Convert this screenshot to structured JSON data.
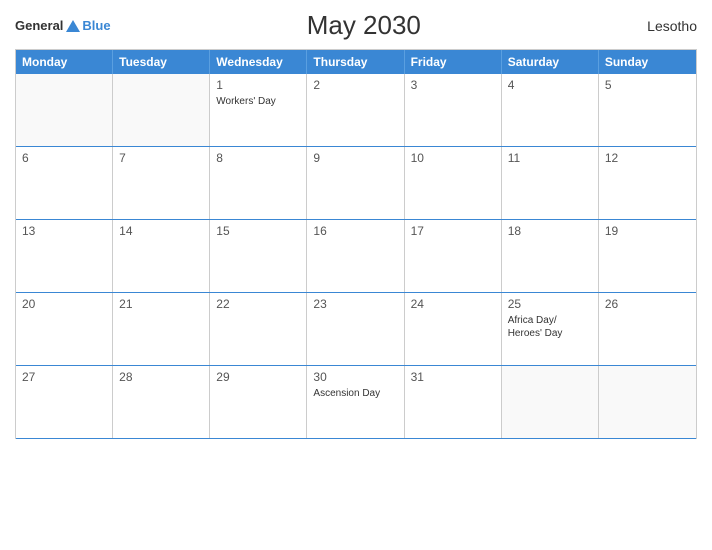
{
  "logo": {
    "general": "General",
    "blue": "Blue"
  },
  "title": "May 2030",
  "country": "Lesotho",
  "headers": [
    "Monday",
    "Tuesday",
    "Wednesday",
    "Thursday",
    "Friday",
    "Saturday",
    "Sunday"
  ],
  "weeks": [
    [
      {
        "day": "",
        "event": "",
        "empty": true
      },
      {
        "day": "",
        "event": "",
        "empty": true
      },
      {
        "day": "1",
        "event": "Workers' Day",
        "empty": false
      },
      {
        "day": "2",
        "event": "",
        "empty": false
      },
      {
        "day": "3",
        "event": "",
        "empty": false
      },
      {
        "day": "4",
        "event": "",
        "empty": false
      },
      {
        "day": "5",
        "event": "",
        "empty": false
      }
    ],
    [
      {
        "day": "6",
        "event": "",
        "empty": false
      },
      {
        "day": "7",
        "event": "",
        "empty": false
      },
      {
        "day": "8",
        "event": "",
        "empty": false
      },
      {
        "day": "9",
        "event": "",
        "empty": false
      },
      {
        "day": "10",
        "event": "",
        "empty": false
      },
      {
        "day": "11",
        "event": "",
        "empty": false
      },
      {
        "day": "12",
        "event": "",
        "empty": false
      }
    ],
    [
      {
        "day": "13",
        "event": "",
        "empty": false
      },
      {
        "day": "14",
        "event": "",
        "empty": false
      },
      {
        "day": "15",
        "event": "",
        "empty": false
      },
      {
        "day": "16",
        "event": "",
        "empty": false
      },
      {
        "day": "17",
        "event": "",
        "empty": false
      },
      {
        "day": "18",
        "event": "",
        "empty": false
      },
      {
        "day": "19",
        "event": "",
        "empty": false
      }
    ],
    [
      {
        "day": "20",
        "event": "",
        "empty": false
      },
      {
        "day": "21",
        "event": "",
        "empty": false
      },
      {
        "day": "22",
        "event": "",
        "empty": false
      },
      {
        "day": "23",
        "event": "",
        "empty": false
      },
      {
        "day": "24",
        "event": "",
        "empty": false
      },
      {
        "day": "25",
        "event": "Africa Day/ Heroes' Day",
        "empty": false
      },
      {
        "day": "26",
        "event": "",
        "empty": false
      }
    ],
    [
      {
        "day": "27",
        "event": "",
        "empty": false
      },
      {
        "day": "28",
        "event": "",
        "empty": false
      },
      {
        "day": "29",
        "event": "",
        "empty": false
      },
      {
        "day": "30",
        "event": "Ascension Day",
        "empty": false
      },
      {
        "day": "31",
        "event": "",
        "empty": false
      },
      {
        "day": "",
        "event": "",
        "empty": true
      },
      {
        "day": "",
        "event": "",
        "empty": true
      }
    ]
  ]
}
